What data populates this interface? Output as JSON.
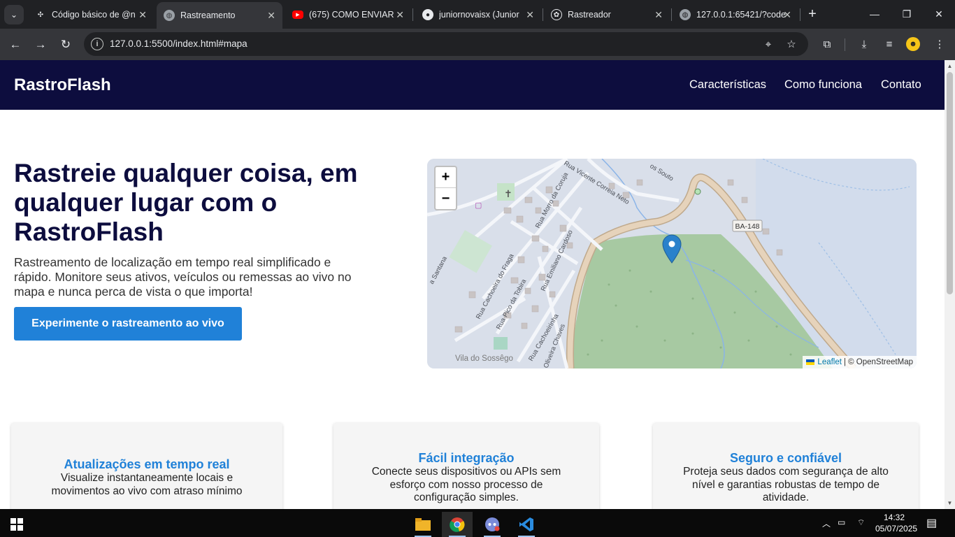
{
  "browser": {
    "tabs": [
      {
        "title": "Código básico de @n",
        "icon": "copilot-icon",
        "active": false
      },
      {
        "title": "Rastreamento",
        "icon": "globe-icon",
        "active": true
      },
      {
        "title": "(675) COMO ENVIAR",
        "icon": "youtube-icon",
        "active": false
      },
      {
        "title": "juniornovaisx (Junior",
        "icon": "github-icon",
        "active": false
      },
      {
        "title": "Rastreador",
        "icon": "openai-icon",
        "active": false
      },
      {
        "title": "127.0.0.1:65421/?code",
        "icon": "globe-icon",
        "active": false
      }
    ],
    "url": "127.0.0.1:5500/index.html#mapa"
  },
  "site": {
    "brand": "RastroFlash",
    "nav": [
      "Características",
      "Como funciona",
      "Contato"
    ],
    "hero": {
      "title": "Rastreie qualquer coisa, em qualquer lugar com o RastroFlash",
      "subtitle": "Rastreamento de localização em tempo real simplificado e rápido. Monitore seus ativos, veículos ou remessas ao vivo no mapa e nunca perca de vista o que importa!",
      "cta": "Experimente o rastreamento ao vivo"
    },
    "map": {
      "zoom_in": "+",
      "zoom_out": "−",
      "attribution_link": "Leaflet",
      "attribution_text": "| © OpenStreetMap",
      "labels": {
        "road_badge": "BA-148",
        "street_1": "Rua Vicente Correia Neto",
        "street_2": "Rua Morro da Coruja",
        "street_3": "Rua Emiliano Cardoso",
        "street_4": "Rua Cachoeira do Fraga",
        "street_5": "Rua Pico da Tobira",
        "street_6": "Rua Cachoeirinha",
        "street_7": "Oliveira Chaves",
        "street_8": "a Santana",
        "street_9": "os Souto",
        "place": "Vila do Sossêgo"
      }
    },
    "features": [
      {
        "title": "Atualizações em tempo real",
        "text": "Visualize instantaneamente locais e movimentos ao vivo com atraso mínimo"
      },
      {
        "title": "Fácil integração",
        "text": "Conecte seus dispositivos ou APIs sem esforço com nosso processo de configuração simples."
      },
      {
        "title": "Seguro e confiável",
        "text": "Proteja seus dados com segurança de alto nível e garantias robustas de tempo de atividade."
      }
    ]
  },
  "taskbar": {
    "time": "14:32",
    "date": "05/07/2025"
  }
}
